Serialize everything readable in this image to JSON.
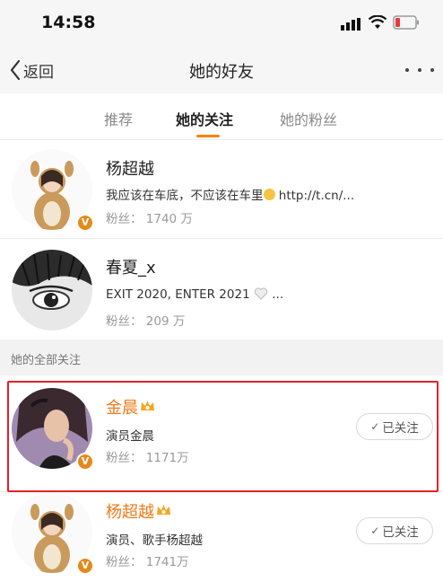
{
  "status_bar": {
    "time": "14:58"
  },
  "nav": {
    "back_label": "返回",
    "title": "她的好友"
  },
  "tabs": [
    {
      "label": "推荐",
      "active": false
    },
    {
      "label": "她的关注",
      "active": true
    },
    {
      "label": "她的粉丝",
      "active": false
    }
  ],
  "friends": [
    {
      "name": "杨超越",
      "desc": "我应该在车底，不应该在车里",
      "desc_suffix": " http://t.cn/...",
      "fans": "粉丝： 1740 万",
      "verified": true
    },
    {
      "name": "春夏_x",
      "desc": "EXIT 2020, ENTER 2021 ",
      "desc_suffix": " ...",
      "fans": "粉丝： 209 万",
      "verified": false
    }
  ],
  "section": {
    "label": "她的全部关注"
  },
  "all_following": [
    {
      "name": "金晨",
      "desc": "演员金晨",
      "fans": "粉丝： 1171万",
      "follow_label": "已关注",
      "verified": true,
      "vip": true
    },
    {
      "name": "杨超越",
      "desc": "演员、歌手杨超越",
      "fans": "粉丝： 1741万",
      "follow_label": "已关注",
      "verified": true,
      "vip": true
    }
  ],
  "colors": {
    "accent": "#ff8200",
    "vip_name": "#f27a1a",
    "verified_badge": "#e5891b",
    "highlight": "#e5212a"
  },
  "icons": [
    "back-chevron-icon",
    "more-dots-icon",
    "signal-icon",
    "wifi-icon",
    "battery-icon",
    "verified-v-icon",
    "vip-crown-icon",
    "check-icon"
  ]
}
